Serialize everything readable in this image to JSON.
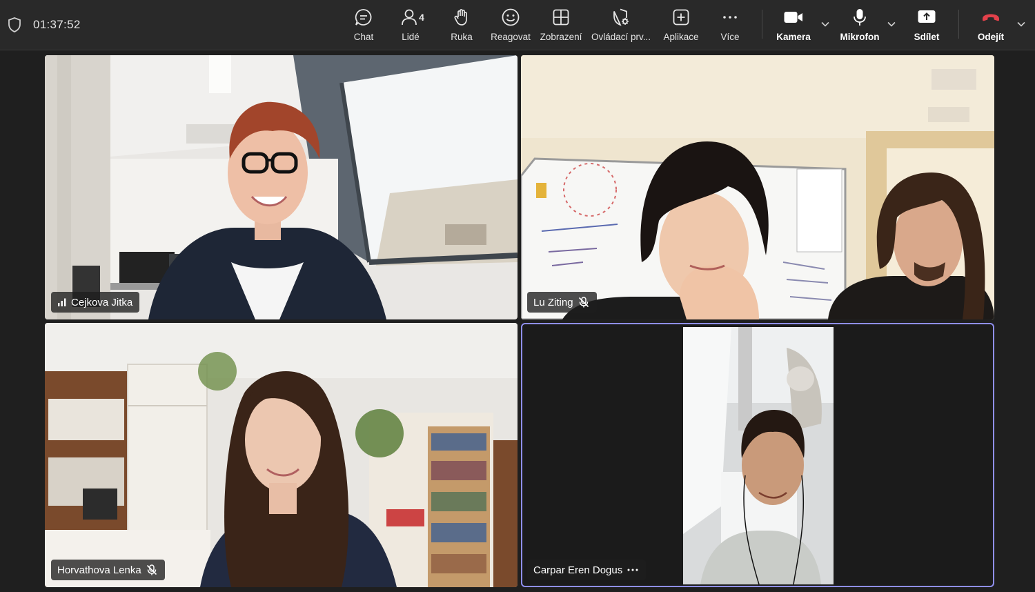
{
  "call": {
    "timer": "01:37:52"
  },
  "toolbar": {
    "chat": "Chat",
    "people": "Lidé",
    "people_count": "4",
    "raise_hand": "Ruka",
    "react": "Reagovat",
    "view": "Zobrazení",
    "controls": "Ovládací prv...",
    "apps": "Aplikace",
    "more": "Více",
    "camera": "Kamera",
    "mic": "Mikrofon",
    "share": "Sdílet",
    "leave": "Odejít"
  },
  "participants": [
    {
      "name": "Cejkova Jitka",
      "status": "signal-bars-icon"
    },
    {
      "name": "Lu Ziting",
      "status": "mic-muted-icon"
    },
    {
      "name": "Horvathova Lenka",
      "status": "mic-muted-icon"
    },
    {
      "name": "Carpar Eren Dogus",
      "status": "more-options-icon"
    }
  ],
  "colors": {
    "background": "#1f1f1f",
    "topbar": "#292929",
    "active_speaker_border": "#8f8ff0",
    "leave_red": "#e3414b"
  }
}
